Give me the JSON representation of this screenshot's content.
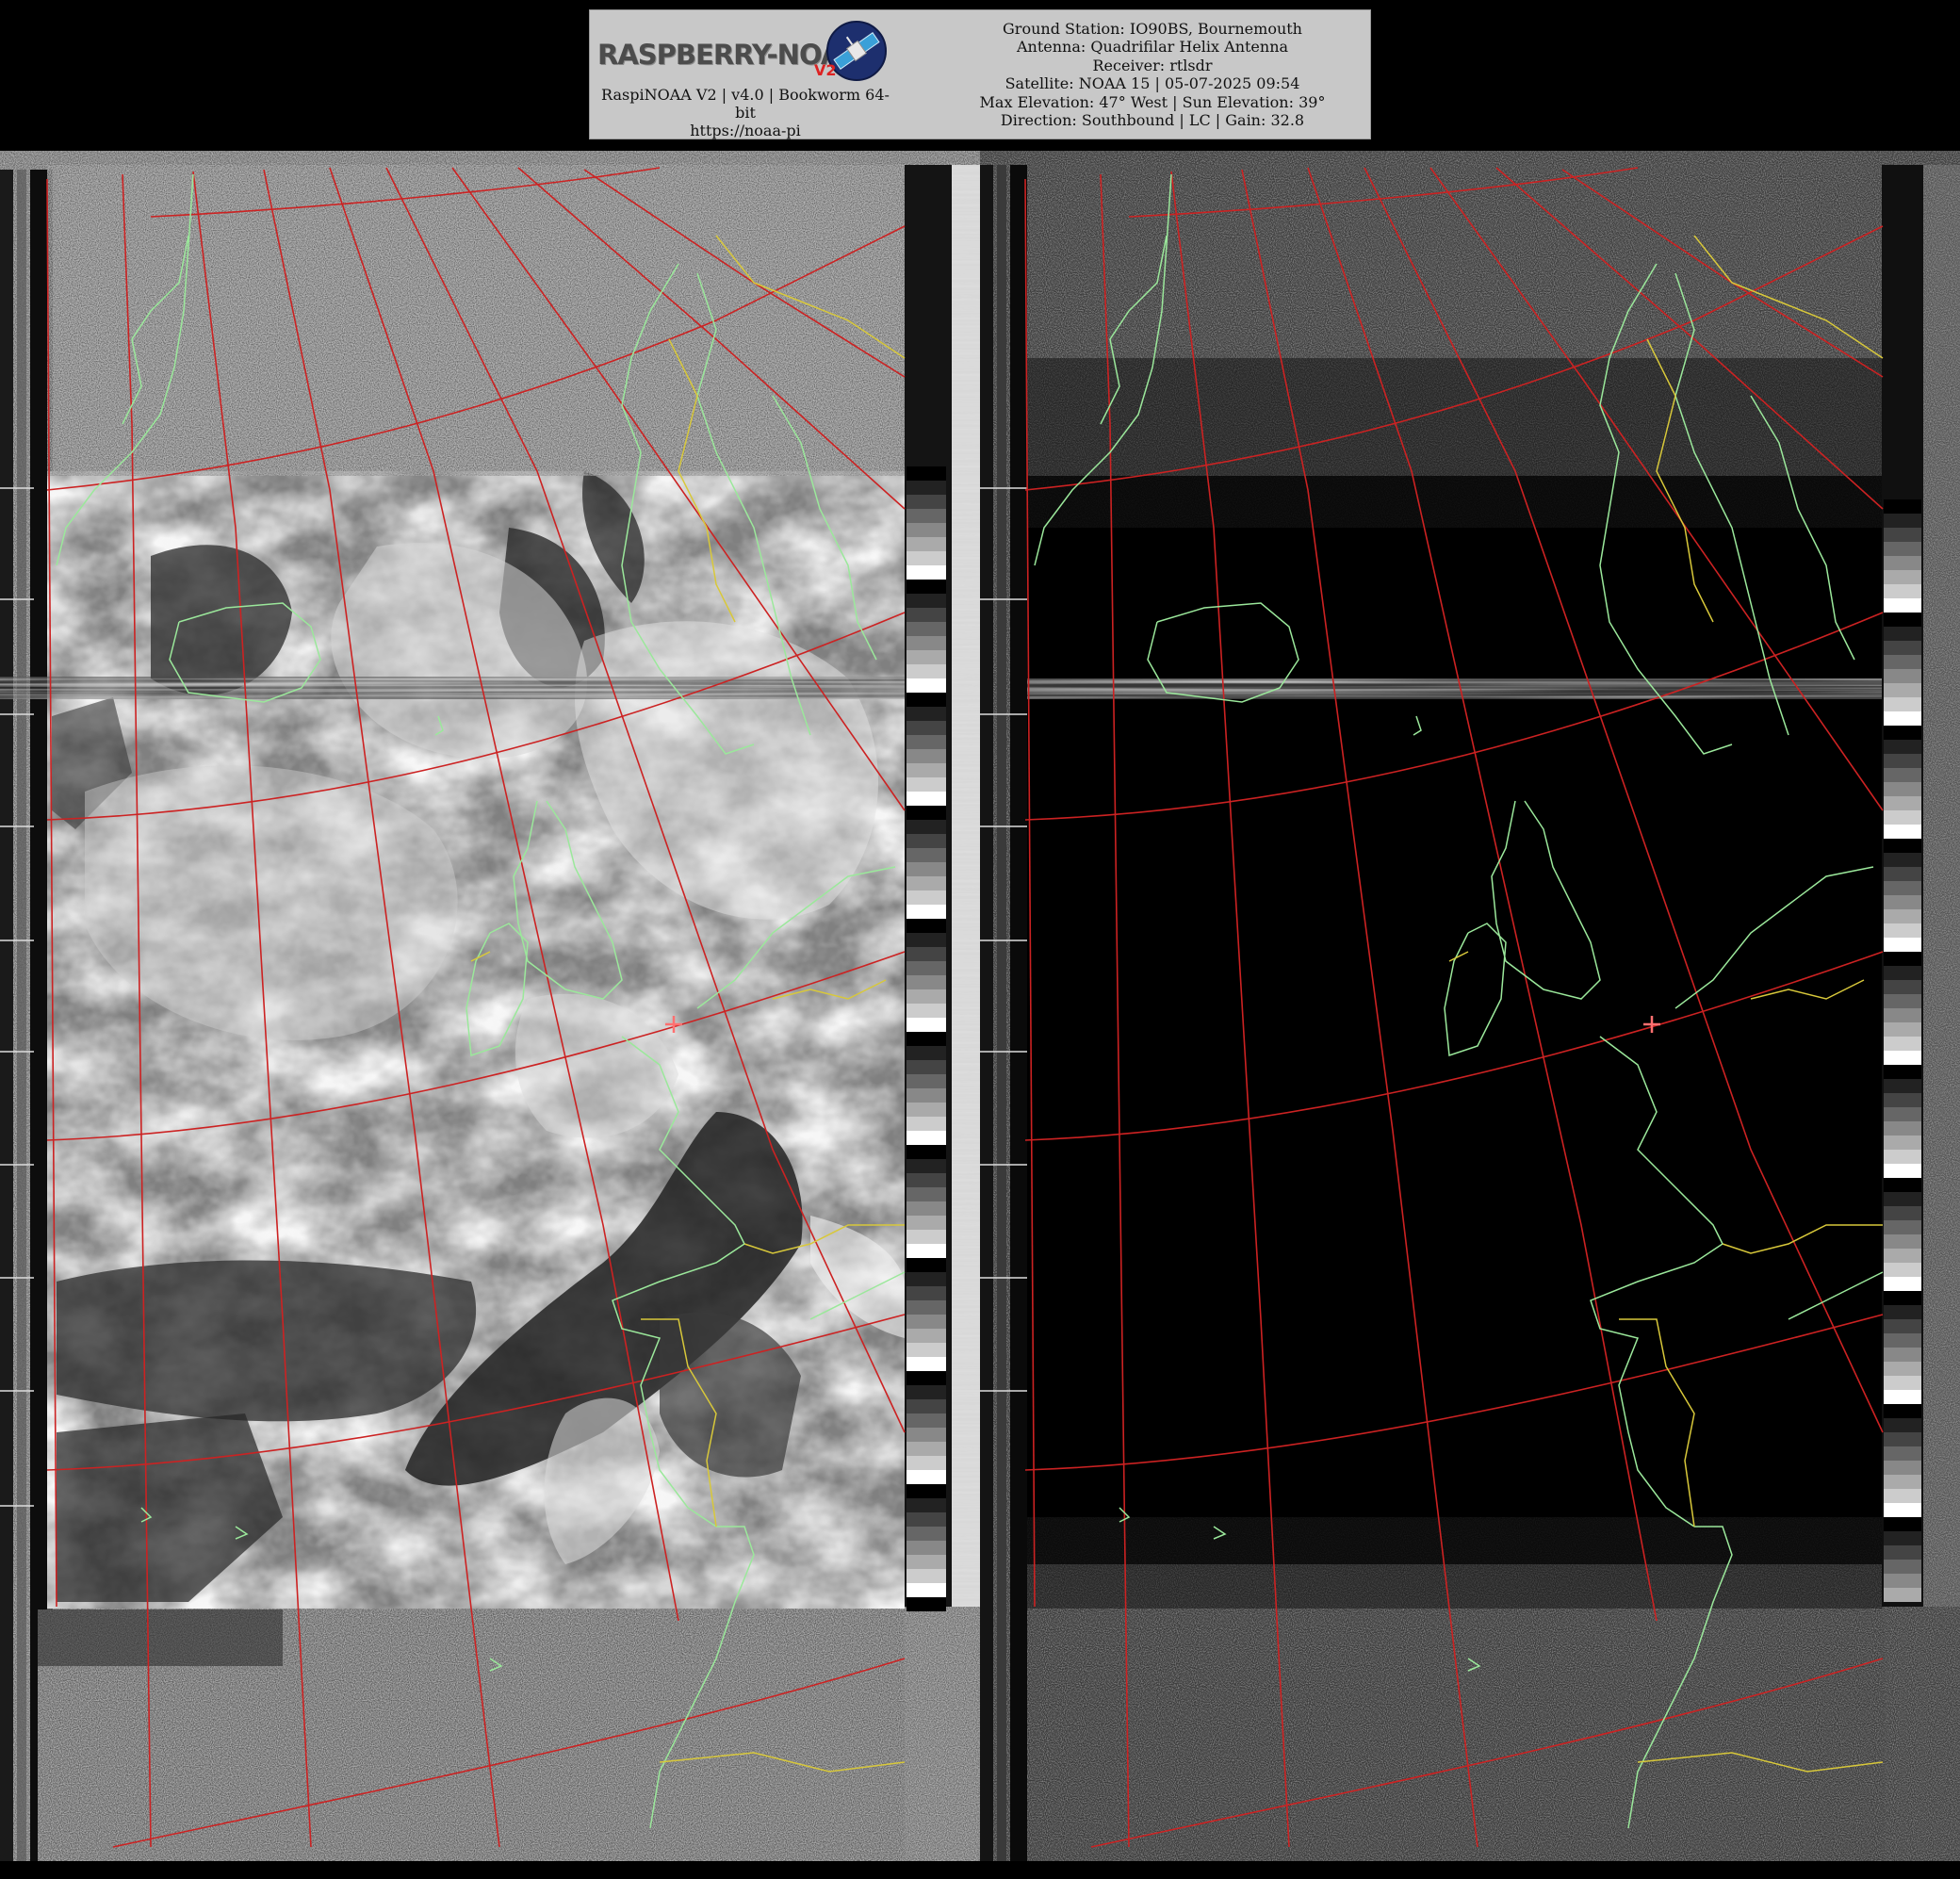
{
  "header": {
    "logo_text": "RASPBERRY-NOAA",
    "logo_badge": "V2",
    "caption_line1": "RaspiNOAA V2 | v4.0 | Bookworm 64-",
    "caption_line2": "bit",
    "caption_line3": "https://noaa-pi",
    "station_lines": [
      "Ground Station: IO90BS, Bournemouth",
      "Antenna: Quadrifilar Helix Antenna",
      "Receiver: rtlsdr",
      "Satellite: NOAA 15 | 05-07-2025 09:54",
      "Max Elevation: 47° West | Sun Elevation: 39°",
      "Direction: Southbound | LC | Gain: 32.8"
    ]
  },
  "imagery": {
    "left_channel": "visible",
    "right_channel": "infrared",
    "overlay_colors": {
      "graticule": "#cc2222",
      "coastline": "#9be89b",
      "borders": "#d8c83a",
      "station_marker": "#ff6a6a"
    },
    "icons": [
      "satellite-icon",
      "station-marker-icon"
    ]
  }
}
